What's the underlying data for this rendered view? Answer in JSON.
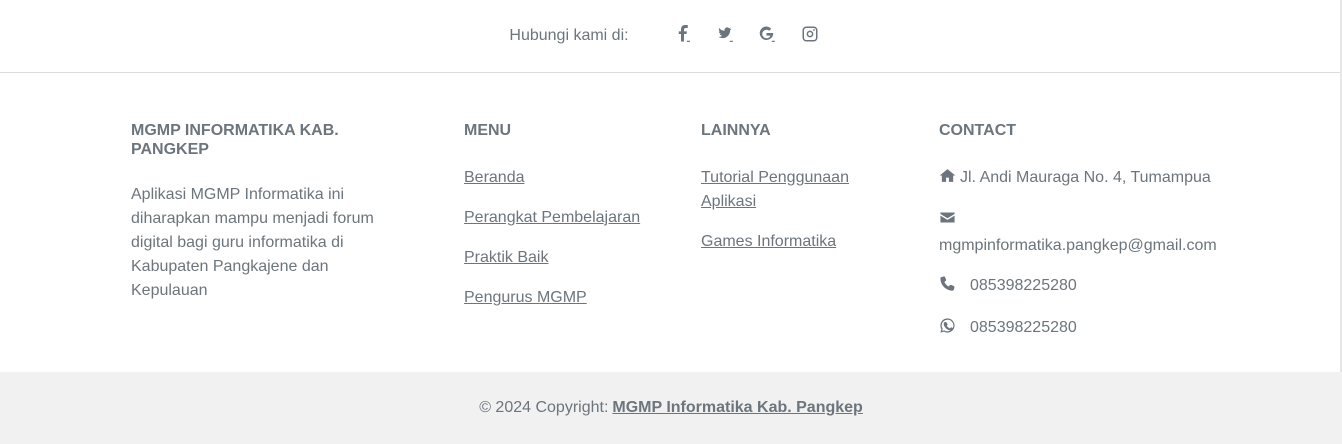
{
  "social": {
    "label": "Hubungi kami di:",
    "links": [
      {
        "icon": "facebook-icon"
      },
      {
        "icon": "twitter-icon"
      },
      {
        "icon": "google-icon"
      },
      {
        "icon": "instagram-icon"
      }
    ]
  },
  "about": {
    "title": "MGMP INFORMATIKA KAB. PANGKEP",
    "text": "Aplikasi MGMP Informatika ini diharapkan mampu menjadi forum digital bagi guru informatika di Kabupaten Pangkajene dan Kepulauan"
  },
  "menu": {
    "title": "MENU",
    "items": [
      {
        "label": "Beranda"
      },
      {
        "label": "Perangkat Pembelajaran"
      },
      {
        "label": "Praktik Baik"
      },
      {
        "label": "Pengurus MGMP"
      }
    ]
  },
  "other": {
    "title": "LAINNYA",
    "items": [
      {
        "label": "Tutorial Penggunaan Aplikasi"
      },
      {
        "label": "Games Informatika"
      }
    ]
  },
  "contact": {
    "title": "CONTACT",
    "address": "Jl. Andi Mauraga No. 4, Tumampua",
    "email": "mgmpinformatika.pangkep@gmail.com",
    "phone": "085398225280",
    "whatsapp": "085398225280",
    "icons": {
      "address": "home-icon",
      "email": "envelope-icon",
      "phone": "phone-icon",
      "whatsapp": "whatsapp-icon"
    }
  },
  "copyright": {
    "prefix": "© 2024 Copyright:",
    "link": "MGMP Informatika Kab. Pangkep"
  },
  "colors": {
    "text": "#6c757d",
    "copyright_bg": "#f1f1f1",
    "border": "#dcdcdc"
  }
}
